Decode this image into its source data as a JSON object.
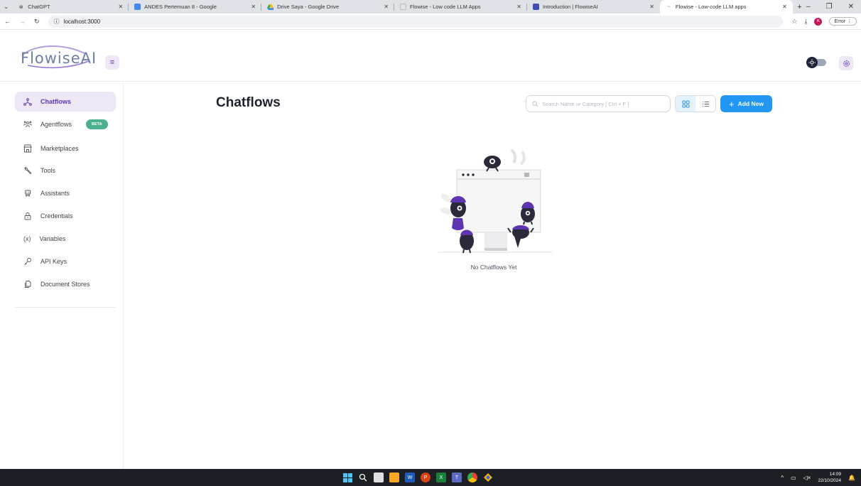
{
  "browser": {
    "tabs": [
      {
        "title": "ChatGPT",
        "favicon": "chatgpt-icon",
        "active": false
      },
      {
        "title": "ANDES Pertemuan 8 - Google",
        "favicon": "google-docs-icon",
        "active": false
      },
      {
        "title": "Drive Saya - Google Drive",
        "favicon": "google-drive-icon",
        "active": false
      },
      {
        "title": "Flowise - Low code LLM Apps",
        "favicon": "flowise-icon",
        "active": false
      },
      {
        "title": "Introduction | FlowiseAI",
        "favicon": "flowise-docs-icon",
        "active": false
      },
      {
        "title": "Flowise - Low-code LLM apps",
        "favicon": "flowise-icon",
        "active": true
      }
    ],
    "url": "localhost:3000",
    "profile_initial": "K",
    "error_label": "Error"
  },
  "app": {
    "logo_text": "FlowiseAI"
  },
  "sidebar": {
    "items": [
      {
        "label": "Chatflows",
        "icon": "hierarchy-icon",
        "active": true
      },
      {
        "label": "Agentflows",
        "icon": "users-group-icon",
        "badge": "BETA"
      },
      {
        "label": "Marketplaces",
        "icon": "building-store-icon"
      },
      {
        "label": "Tools",
        "icon": "tool-icon"
      },
      {
        "label": "Assistants",
        "icon": "robot-icon"
      },
      {
        "label": "Credentials",
        "icon": "lock-icon"
      },
      {
        "label": "Variables",
        "icon": "variable-icon"
      },
      {
        "label": "API Keys",
        "icon": "key-icon"
      },
      {
        "label": "Document Stores",
        "icon": "files-icon"
      }
    ]
  },
  "main": {
    "title": "Chatflows",
    "search_placeholder": "Search Name or Category [ Ctrl + F ]",
    "add_new_label": "Add New",
    "empty_text": "No Chatflows Yet"
  },
  "taskbar": {
    "time": "14:09",
    "date": "22/10/2024"
  },
  "colors": {
    "accent_purple": "#5e35b1",
    "primary_blue": "#2196f3",
    "beta_green": "#4caf8e"
  }
}
